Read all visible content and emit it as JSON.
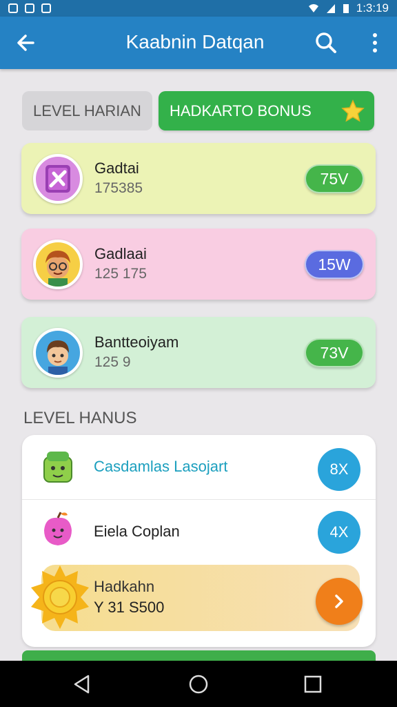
{
  "status_bar": {
    "time": "1:3:19"
  },
  "app_bar": {
    "title": "Kaabnin Datqan"
  },
  "tabs": [
    {
      "label": "LEVEL HARIAN"
    },
    {
      "label": "HADKARTO BONUS"
    }
  ],
  "players": [
    {
      "name": "Gadtai",
      "score": "175385",
      "badge": "75V",
      "color": "#45b54a"
    },
    {
      "name": "Gadlaai",
      "score": "125 175",
      "badge": "15W",
      "color": "#5a6be0"
    },
    {
      "name": "Bantteoiyam",
      "score": "125 9",
      "badge": "73V",
      "color": "#45b54a"
    }
  ],
  "section": {
    "title": "LEVEL HANUS",
    "rows": [
      {
        "label": "Casdamlas Lasojart",
        "badge": "8X"
      },
      {
        "label": "Eiela Coplan",
        "badge": "4X"
      }
    ],
    "bonus": {
      "title": "Hadkahn",
      "value": "Y 31 S500"
    }
  },
  "icons": {
    "back": "arrow-left-icon",
    "search": "search-icon",
    "more": "more-vert-icon",
    "star": "star-icon",
    "go": "chevron-right-icon"
  },
  "colors": {
    "primary": "#2582c4",
    "accent_green": "#33b14a",
    "orange": "#f07f1a"
  }
}
